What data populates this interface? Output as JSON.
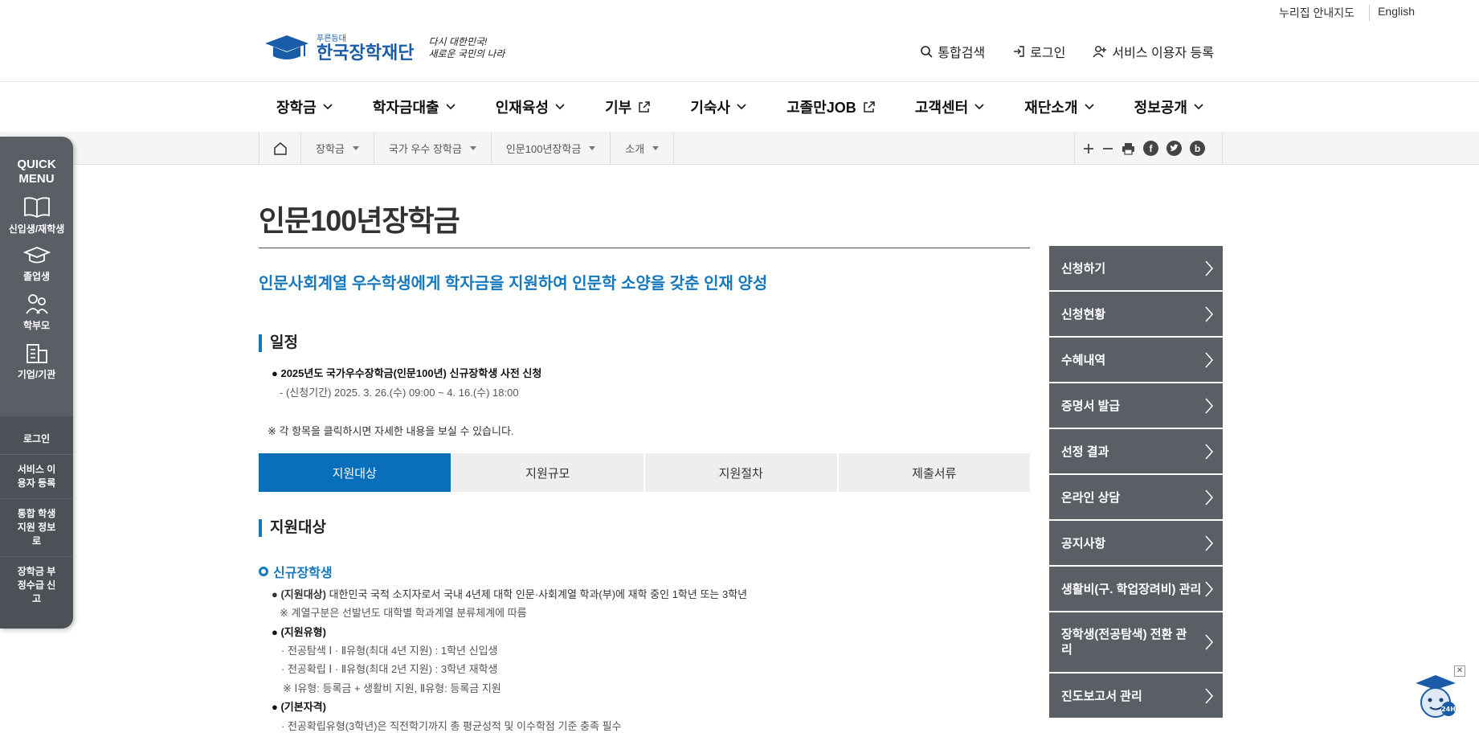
{
  "util": {
    "sitemap": "누리집 안내지도",
    "english": "English"
  },
  "logo": {
    "small": "푸른등대",
    "name": "한국장학재단",
    "slogan_l1": "다시 대한민국!",
    "slogan_l2": "새로운 국민의 나라"
  },
  "header_links": {
    "search": "통합검색",
    "login": "로그인",
    "register": "서비스 이용자 등록"
  },
  "gnb": [
    "장학금",
    "학자금대출",
    "인재육성",
    "기부",
    "기숙사",
    "고졸만JOB",
    "고객센터",
    "재단소개",
    "정보공개"
  ],
  "breadcrumb": [
    "장학금",
    "국가 우수 장학금",
    "인문100년장학금",
    "소개"
  ],
  "tools": {
    "facebook": "f",
    "blog": "b"
  },
  "quick": {
    "title_l1": "QUICK",
    "title_l2": "MENU",
    "items": [
      "신입생/재학생",
      "졸업생",
      "학부모",
      "기업/기관"
    ],
    "lower": [
      "로그인",
      "서비스 이용자 등록",
      "통합 학생지원 정보로",
      "장학금 부정수급 신고"
    ]
  },
  "page": {
    "title": "인문100년장학금",
    "lead": "인문사회계열 우수학생에게 학자금을 지원하여 인문학 소양을 갖춘 인재 양성",
    "schedule_heading": "일정",
    "schedule_item": "2025년도 국가우수장학금(인문100년) 신규장학생 사전 신청",
    "schedule_period": "- (신청기간) 2025. 3. 26.(수) 09:00 ~ 4. 16.(수) 18:00",
    "note": "※ 각 항목을 클릭하시면 자세한 내용을 보실 수 있습니다.",
    "tabs": [
      "지원대상",
      "지원규모",
      "지원절차",
      "제출서류"
    ],
    "section_heading": "지원대상",
    "sub_heading": "신규장학생",
    "target_label": "(지원대상)",
    "target_text": "대한민국 국적 소지자로서 국내 4년제 대학 인문·사회계열 학과(부)에 재학 중인 1학년 또는 3학년",
    "target_note": "※ 계열구분은 선발년도 대학별 학과계열 분류체계에 따름",
    "type_label": "(지원유형)",
    "type_1": "· 전공탐색 Ⅰ · Ⅱ유형(최대 4년 지원) : 1학년 신입생",
    "type_2": "· 전공확립 Ⅰ · Ⅱ유형(최대 2년 지원) : 3학년 재학생",
    "type_note": "※ Ⅰ유형: 등록금 + 생활비 지원, Ⅱ유형: 등록금 지원",
    "basic_label": "(기본자격)",
    "basic_1": "· 전공확립유형(3학년)은 직전학기까지 총 평균성적 및 이수학점 기준 충족 필수"
  },
  "right_menu": [
    "신청하기",
    "신청현황",
    "수혜내역",
    "증명서 발급",
    "선정 결과",
    "온라인 상담",
    "공지사항",
    "생활비(구. 학업장려비) 관리",
    "장학생(전공탐색) 전환 관리",
    "진도보고서 관리"
  ],
  "chatbot": {
    "badge": "24H"
  }
}
